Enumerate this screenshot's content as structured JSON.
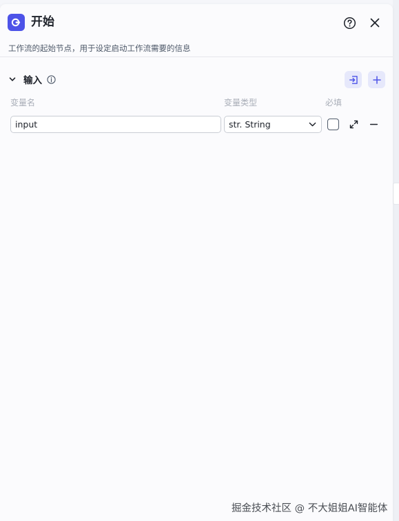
{
  "header": {
    "title": "开始",
    "description": "工作流的起始节点，用于设定启动工作流需要的信息",
    "app_icon": "start-node-icon",
    "help_icon": "help-circle-icon",
    "close_icon": "close-icon"
  },
  "input_section": {
    "title": "输入",
    "info_icon": "info-icon",
    "columns": {
      "name": "变量名",
      "type": "变量类型",
      "required": "必填"
    },
    "rows": [
      {
        "name": "input",
        "type": "str. String",
        "required": false
      }
    ]
  },
  "watermark": "掘金技术社区 @ 不大姐姐AI智能体",
  "colors": {
    "accent": "#4d53e8",
    "accent_light": "#e6e8fb",
    "border": "#c9cdd4",
    "muted_text": "#a9aeb8"
  }
}
